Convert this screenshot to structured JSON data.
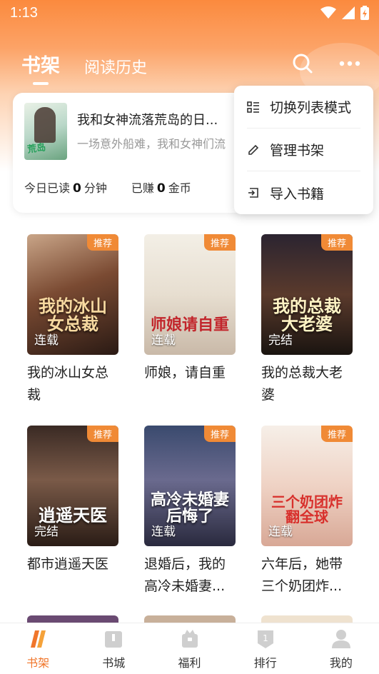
{
  "status_bar": {
    "time": "1:13"
  },
  "header": {
    "tabs": [
      {
        "label": "书架",
        "active": true
      },
      {
        "label": "阅读历史",
        "active": false
      }
    ],
    "accent_color": "#fb8a3e"
  },
  "reading_card": {
    "title": "我和女神流落荒岛的日...",
    "subtitle": "一场意外船难，我和女神们流",
    "stats": {
      "read_prefix": "今日已读",
      "read_value": "0",
      "read_unit": "分钟",
      "earn_prefix": "已赚",
      "earn_value": "0",
      "earn_unit": "金币"
    }
  },
  "menu": {
    "items": [
      {
        "label": "切换列表模式",
        "icon": "list-mode-icon"
      },
      {
        "label": "管理书架",
        "icon": "edit-icon"
      },
      {
        "label": "导入书籍",
        "icon": "import-icon"
      }
    ]
  },
  "books": [
    {
      "title": "我的冰山女总裁",
      "badge": "推荐",
      "status": "连载",
      "cover_text": "我的冰山女总裁"
    },
    {
      "title": "师娘，请自重",
      "badge": "推荐",
      "status": "连载",
      "cover_text": "师娘请自重"
    },
    {
      "title": "我的总裁大老婆",
      "badge": "推荐",
      "status": "完结",
      "cover_text": "我的总裁大老婆"
    },
    {
      "title": "都市逍遥天医",
      "badge": "推荐",
      "status": "完结",
      "cover_text": "逍遥天医"
    },
    {
      "title": "退婚后，我的高冷未婚妻...",
      "badge": "推荐",
      "status": "连载",
      "cover_text": "高冷未婚妻后悔了"
    },
    {
      "title": "六年后，她带三个奶团炸...",
      "badge": "推荐",
      "status": "连载",
      "cover_text": "三个奶团炸翻全球"
    }
  ],
  "bottom_nav": {
    "items": [
      {
        "label": "书架",
        "active": true
      },
      {
        "label": "书城",
        "active": false
      },
      {
        "label": "福利",
        "active": false
      },
      {
        "label": "排行",
        "active": false
      },
      {
        "label": "我的",
        "active": false
      }
    ]
  }
}
